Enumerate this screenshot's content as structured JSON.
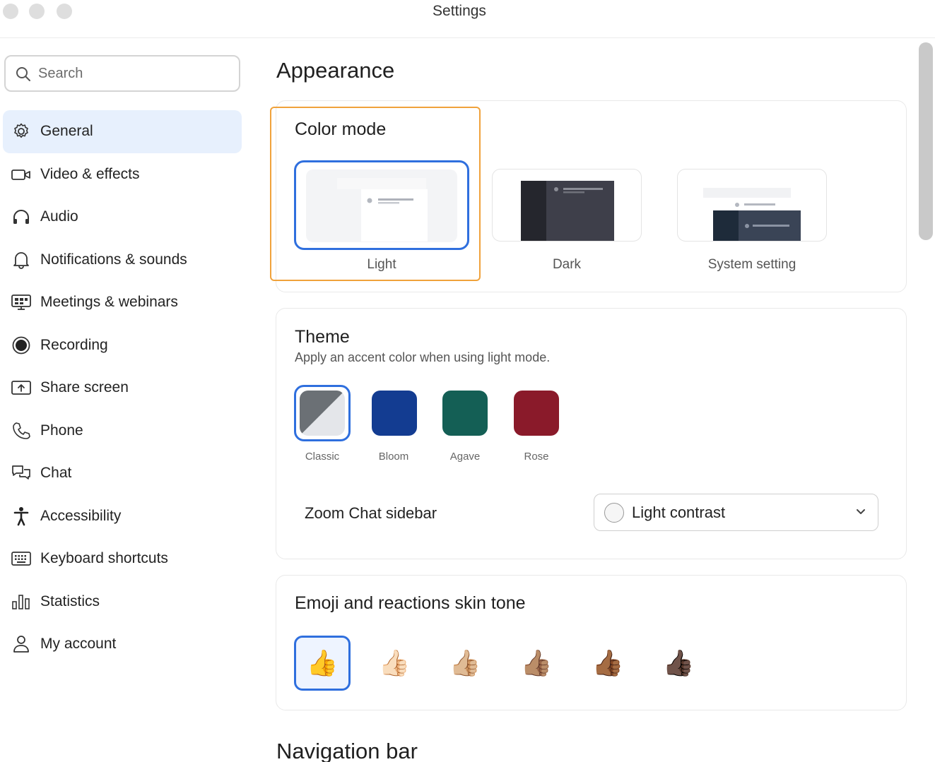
{
  "window": {
    "title": "Settings"
  },
  "search": {
    "placeholder": "Search"
  },
  "sidebar": {
    "items": [
      {
        "label": "General",
        "icon": "gear-icon",
        "active": true
      },
      {
        "label": "Video & effects",
        "icon": "video-camera-icon"
      },
      {
        "label": "Audio",
        "icon": "headphones-icon"
      },
      {
        "label": "Notifications & sounds",
        "icon": "bell-icon"
      },
      {
        "label": "Meetings & webinars",
        "icon": "meetings-icon"
      },
      {
        "label": "Recording",
        "icon": "record-icon"
      },
      {
        "label": "Share screen",
        "icon": "share-screen-icon"
      },
      {
        "label": "Phone",
        "icon": "phone-icon"
      },
      {
        "label": "Chat",
        "icon": "chat-icon"
      },
      {
        "label": "Accessibility",
        "icon": "accessibility-icon"
      },
      {
        "label": "Keyboard shortcuts",
        "icon": "keyboard-icon"
      },
      {
        "label": "Statistics",
        "icon": "statistics-icon"
      },
      {
        "label": "My account",
        "icon": "person-icon"
      }
    ]
  },
  "main": {
    "heading": "Appearance",
    "color_mode": {
      "title": "Color mode",
      "options": [
        {
          "label": "Light",
          "selected": true
        },
        {
          "label": "Dark"
        },
        {
          "label": "System setting"
        }
      ]
    },
    "theme": {
      "title": "Theme",
      "subtitle": "Apply an accent color when using light mode.",
      "swatches": [
        {
          "label": "Classic",
          "color": "#6b7075",
          "selected": true
        },
        {
          "label": "Bloom",
          "color": "#133c91"
        },
        {
          "label": "Agave",
          "color": "#145f55"
        },
        {
          "label": "Rose",
          "color": "#8a1a2a"
        }
      ],
      "zoom_chat_sidebar": {
        "label": "Zoom Chat sidebar",
        "value": "Light contrast"
      }
    },
    "emoji": {
      "title": "Emoji and reactions skin tone",
      "tones": [
        "👍",
        "👍🏻",
        "👍🏼",
        "👍🏽",
        "👍🏾",
        "👍🏿"
      ]
    },
    "next_heading": "Navigation bar"
  },
  "colors": {
    "accent": "#2f6fde",
    "highlight": "#f0a23b",
    "active_bg": "#e7f0fd"
  }
}
